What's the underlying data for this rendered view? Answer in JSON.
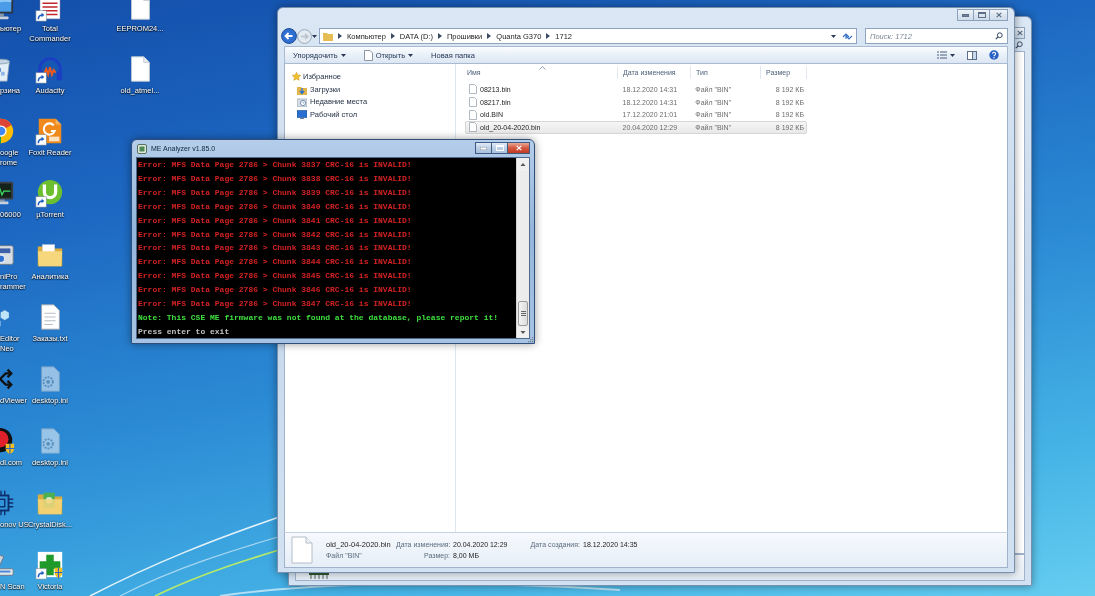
{
  "desktop": {
    "columns": [
      {
        "icons": [
          {
            "label": "ьютер"
          },
          {
            "label": "рзина"
          },
          {
            "label": "oogle rome"
          },
          {
            "label": "06000"
          },
          {
            "label": "niPro rammer"
          },
          {
            "label": "Editor Neo"
          },
          {
            "label": "dViewer"
          },
          {
            "label": "dl.com"
          },
          {
            "label": "onov US"
          },
          {
            "label": "N Scan"
          }
        ]
      },
      {
        "icons": [
          {
            "label": "Total Commander",
            "shortcut": true
          },
          {
            "label": "Audacity",
            "shortcut": true
          },
          {
            "label": "Foxit Reader",
            "shortcut": true
          },
          {
            "label": "µTorrent",
            "shortcut": true
          },
          {
            "label": "Аналитика",
            "shortcut": false
          },
          {
            "label": "Заказы.txt",
            "shortcut": false
          },
          {
            "label": "desktop.ini",
            "shortcut": false
          },
          {
            "label": "desktop.ini",
            "shortcut": false
          },
          {
            "label": "CrystalDisk...",
            "shortcut": false
          },
          {
            "label": "Victoria",
            "shortcut": true
          }
        ]
      },
      {
        "icons": [
          {
            "label": "EEPROM24...",
            "shortcut": false
          },
          {
            "label": "old_atmel...",
            "shortcut": false
          }
        ]
      }
    ]
  },
  "explorer": {
    "address": [
      "Компьютер",
      "DATA (D:)",
      "Прошивки",
      "Quanta G370",
      "1712"
    ],
    "search": {
      "placeholder": "Поиск: 1712"
    },
    "toolbar": [
      {
        "label": "Упорядочить",
        "kind": "menu"
      },
      {
        "label": "Открыть",
        "kind": "split"
      },
      {
        "label": "Новая папка",
        "kind": "plain"
      }
    ],
    "nav": [
      {
        "label": "Избранное",
        "children": [
          {
            "label": "Загрузки"
          },
          {
            "label": "Недавние места"
          },
          {
            "label": "Рабочий стол"
          }
        ]
      }
    ],
    "table": {
      "columns": [
        "Имя",
        "Дата изменения",
        "Тип",
        "Размер"
      ],
      "rows": [
        {
          "cells": [
            "08213.bin",
            "18.12.2020 14:31",
            "Файл \"BIN\"",
            "8 192 КБ"
          ],
          "selected": false
        },
        {
          "cells": [
            "08217.bin",
            "18.12.2020 14:31",
            "Файл \"BIN\"",
            "8 192 КБ"
          ],
          "selected": false
        },
        {
          "cells": [
            "old.BIN",
            "17.12.2020 21:01",
            "Файл \"BIN\"",
            "8 192 КБ"
          ],
          "selected": false
        },
        {
          "cells": [
            "old_20-04-2020.bin",
            "20.04.2020 12:29",
            "Файл \"BIN\"",
            "8 192 КБ"
          ],
          "selected": true
        }
      ]
    },
    "details": {
      "name": "old_20-04-2020.bin",
      "type": "Файл \"BIN\"",
      "fields": [
        {
          "label": "Дата изменения:",
          "value": "20.04.2020 12:29"
        },
        {
          "label": "Дата создания:",
          "value": "18.12.2020 14:35"
        },
        {
          "label": "Размер:",
          "value": "8,00 МБ"
        }
      ]
    }
  },
  "console": {
    "title": "ME Analyzer v1.85.0",
    "lines": [
      {
        "kind": "error",
        "text": "Error: MFS Data Page 2786 > Chunk 3837 CRC-16 is INVALID!"
      },
      {
        "kind": "error",
        "text": "Error: MFS Data Page 2786 > Chunk 3838 CRC-16 is INVALID!"
      },
      {
        "kind": "error",
        "text": "Error: MFS Data Page 2786 > Chunk 3839 CRC-16 is INVALID!"
      },
      {
        "kind": "error",
        "text": "Error: MFS Data Page 2786 > Chunk 3840 CRC-16 is INVALID!"
      },
      {
        "kind": "error",
        "text": "Error: MFS Data Page 2786 > Chunk 3841 CRC-16 is INVALID!"
      },
      {
        "kind": "error",
        "text": "Error: MFS Data Page 2786 > Chunk 3842 CRC-16 is INVALID!"
      },
      {
        "kind": "error",
        "text": "Error: MFS Data Page 2786 > Chunk 3843 CRC-16 is INVALID!"
      },
      {
        "kind": "error",
        "text": "Error: MFS Data Page 2786 > Chunk 3844 CRC-16 is INVALID!"
      },
      {
        "kind": "error",
        "text": "Error: MFS Data Page 2786 > Chunk 3845 CRC-16 is INVALID!"
      },
      {
        "kind": "error",
        "text": "Error: MFS Data Page 2786 > Chunk 3846 CRC-16 is INVALID!"
      },
      {
        "kind": "error",
        "text": "Error: MFS Data Page 2786 > Chunk 3847 CRC-16 is INVALID!"
      },
      {
        "kind": "note",
        "text": "Note: This CSE ME firmware was not found at the database, please report it!"
      },
      {
        "kind": "prompt",
        "text": "Press enter to exit"
      }
    ]
  }
}
